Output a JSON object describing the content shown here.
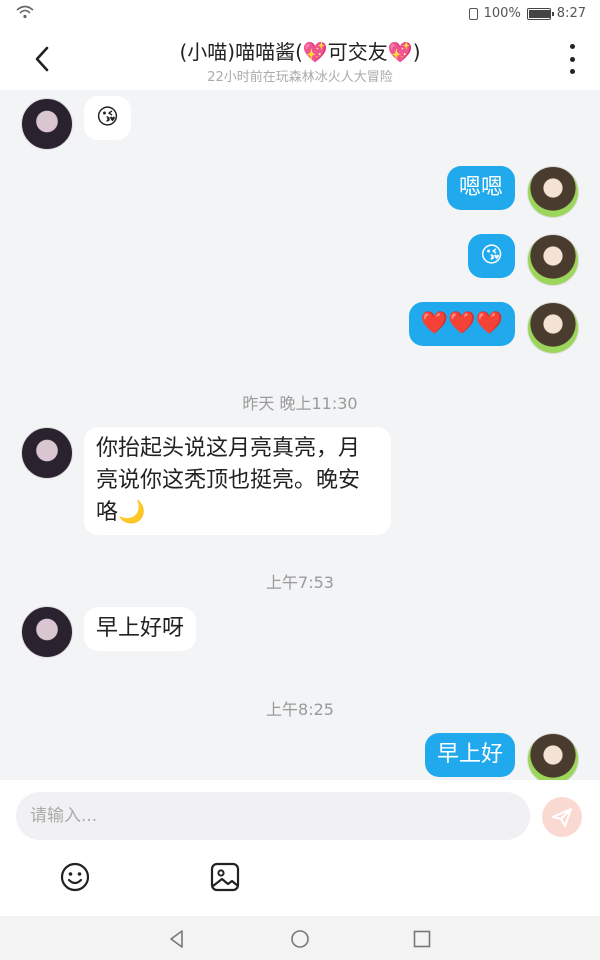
{
  "status": {
    "battery": "100%",
    "time": "8:27",
    "battery_level": 1.0
  },
  "header": {
    "title": "(小喵)喵喵酱(💖可交友💖)",
    "subtitle": "22小时前在玩森林冰火人大冒险"
  },
  "messages": [
    {
      "from": "other",
      "text": "😘"
    },
    {
      "from": "me",
      "text": "嗯嗯"
    },
    {
      "from": "me",
      "text": "😘"
    },
    {
      "from": "me",
      "text": "❤️❤️❤️"
    },
    {
      "type": "time",
      "text": "昨天 晚上11:30"
    },
    {
      "from": "other",
      "text": "你抬起头说这月亮真亮，月亮说你这秃顶也挺亮。晚安咯🌙"
    },
    {
      "type": "time",
      "text": "上午7:53"
    },
    {
      "from": "other",
      "text": "早上好呀"
    },
    {
      "type": "time",
      "text": "上午8:25"
    },
    {
      "from": "me",
      "text": "早上好"
    }
  ],
  "input": {
    "placeholder": "请输入..."
  },
  "icons": {
    "back": "back-arrow-icon",
    "more": "more-vertical-icon",
    "send": "send-icon",
    "emoji": "emoji-icon",
    "image": "image-icon"
  },
  "colors": {
    "outgoing_bubble": "#21a9ee",
    "incoming_bubble": "#ffffff",
    "send_button": "#fbd9d3",
    "background": "#f3f4f6"
  }
}
